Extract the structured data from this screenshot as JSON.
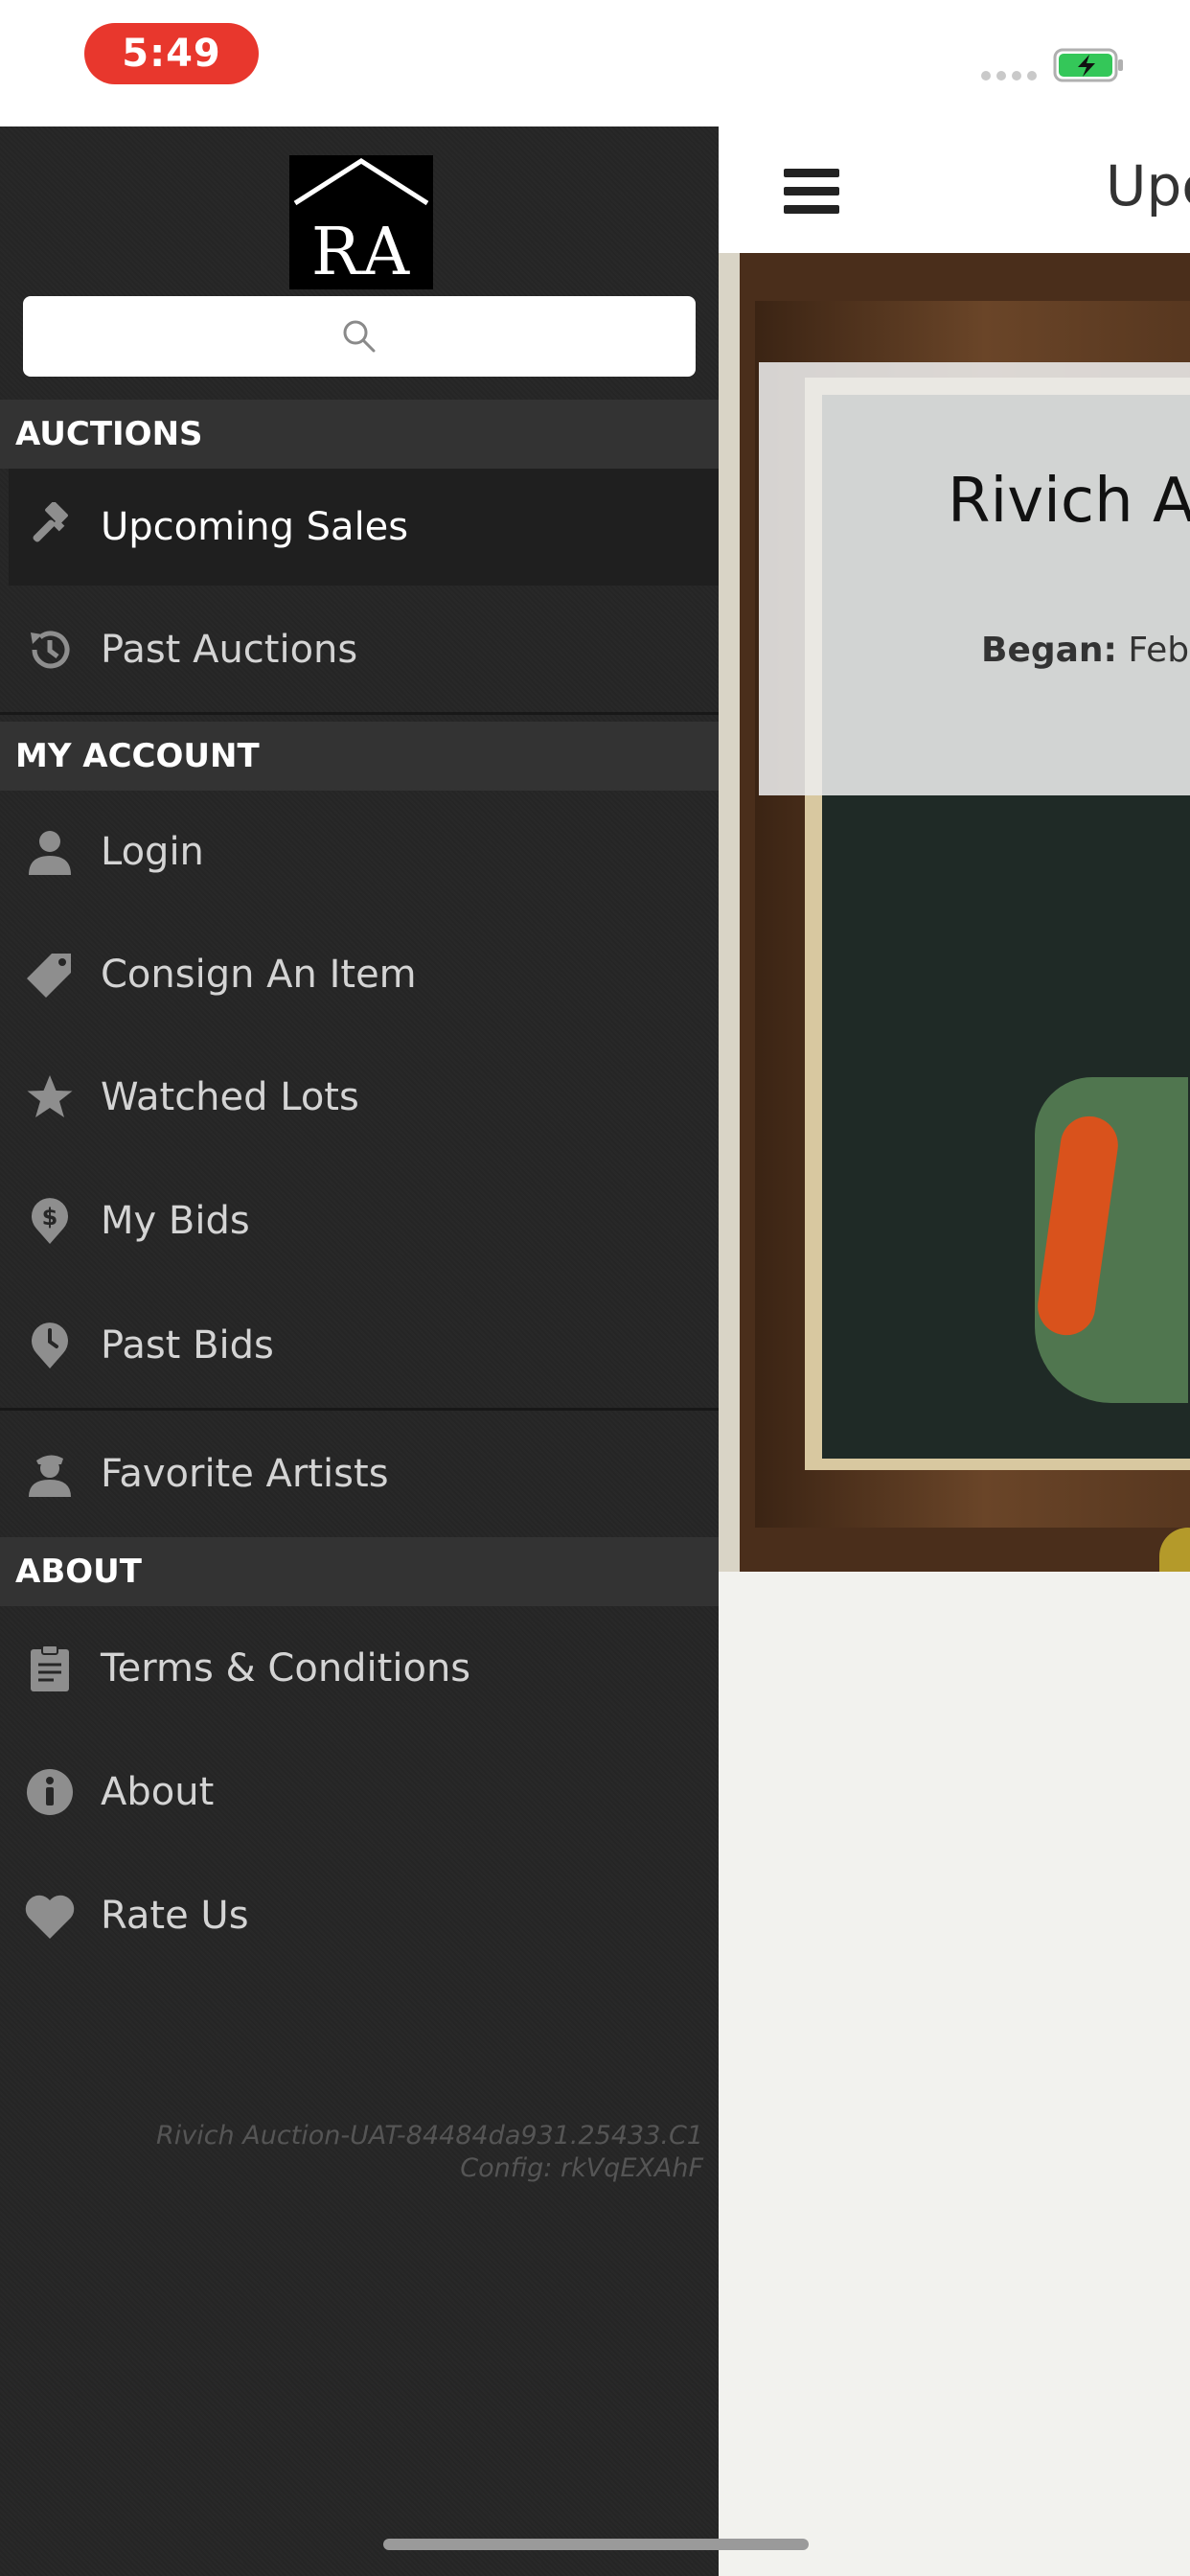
{
  "status_bar": {
    "time": "5:49",
    "colors": {
      "time_pill": "#e8372d",
      "battery": "#34c759"
    }
  },
  "drawer": {
    "logo": {
      "text": "RA"
    },
    "search": {
      "icon": "search-icon",
      "placeholder": ""
    },
    "sections": [
      {
        "title": "AUCTIONS",
        "items": [
          {
            "label": "Upcoming Sales",
            "icon": "gavel-icon",
            "active": true
          },
          {
            "label": "Past Auctions",
            "icon": "history-icon",
            "active": false
          }
        ]
      },
      {
        "title": "MY ACCOUNT",
        "items": [
          {
            "label": "Login",
            "icon": "person-icon"
          },
          {
            "label": "Consign An Item",
            "icon": "tag-icon"
          },
          {
            "label": "Watched Lots",
            "icon": "star-icon"
          },
          {
            "label": "My Bids",
            "icon": "dollar-pin-icon"
          },
          {
            "label": "Past Bids",
            "icon": "clock-pin-icon"
          },
          {
            "label": "Favorite Artists",
            "icon": "artist-icon"
          }
        ]
      },
      {
        "title": "ABOUT",
        "items": [
          {
            "label": "Terms & Conditions",
            "icon": "clipboard-icon"
          },
          {
            "label": "About",
            "icon": "info-icon"
          },
          {
            "label": "Rate Us",
            "icon": "heart-icon"
          }
        ]
      }
    ],
    "version": {
      "build": "Rivich Auction-UAT-84484da931.25433.C1",
      "config": "Config: rkVqEXAhF"
    },
    "colors": {
      "background": "#262626",
      "section_header": "#333333",
      "item_text": "#d4d4d4"
    }
  },
  "main": {
    "nav_title": "Upcoming Sales",
    "sale_card": {
      "title": "Rivich Auction",
      "began_label": "Began:",
      "began_value": "February"
    }
  }
}
